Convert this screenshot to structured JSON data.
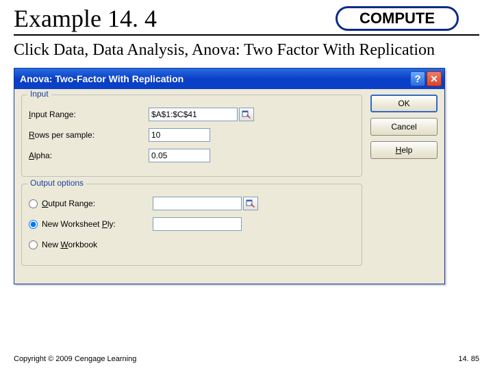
{
  "slide": {
    "title": "Example 14. 4",
    "badge": "COMPUTE",
    "instruction": "Click Data, Data Analysis, Anova: Two Factor With Replication"
  },
  "dialog": {
    "title": "Anova: Two-Factor With Replication",
    "groups": {
      "input_title": "Input",
      "output_title": "Output options"
    },
    "labels": {
      "input_range_pre": "",
      "input_range_u": "I",
      "input_range_post": "nput Range:",
      "rows_pre": "",
      "rows_u": "R",
      "rows_post": "ows per sample:",
      "alpha_pre": "",
      "alpha_u": "A",
      "alpha_post": "lpha:",
      "out_range_pre": "",
      "out_range_u": "O",
      "out_range_post": "utput Range:",
      "new_ply_pre": "New Worksheet ",
      "new_ply_u": "P",
      "new_ply_post": "ly:",
      "new_wb_pre": "New ",
      "new_wb_u": "W",
      "new_wb_post": "orkbook"
    },
    "values": {
      "input_range": "$A$1:$C$41",
      "rows": "10",
      "alpha": "0.05",
      "output_range": "",
      "new_ply": ""
    },
    "buttons": {
      "ok": "OK",
      "cancel": "Cancel",
      "help_pre": "",
      "help_u": "H",
      "help_post": "elp"
    },
    "output_selected": "new_ply"
  },
  "footer": {
    "copyright": "Copyright © 2009 Cengage Learning",
    "page": "14. 85"
  }
}
